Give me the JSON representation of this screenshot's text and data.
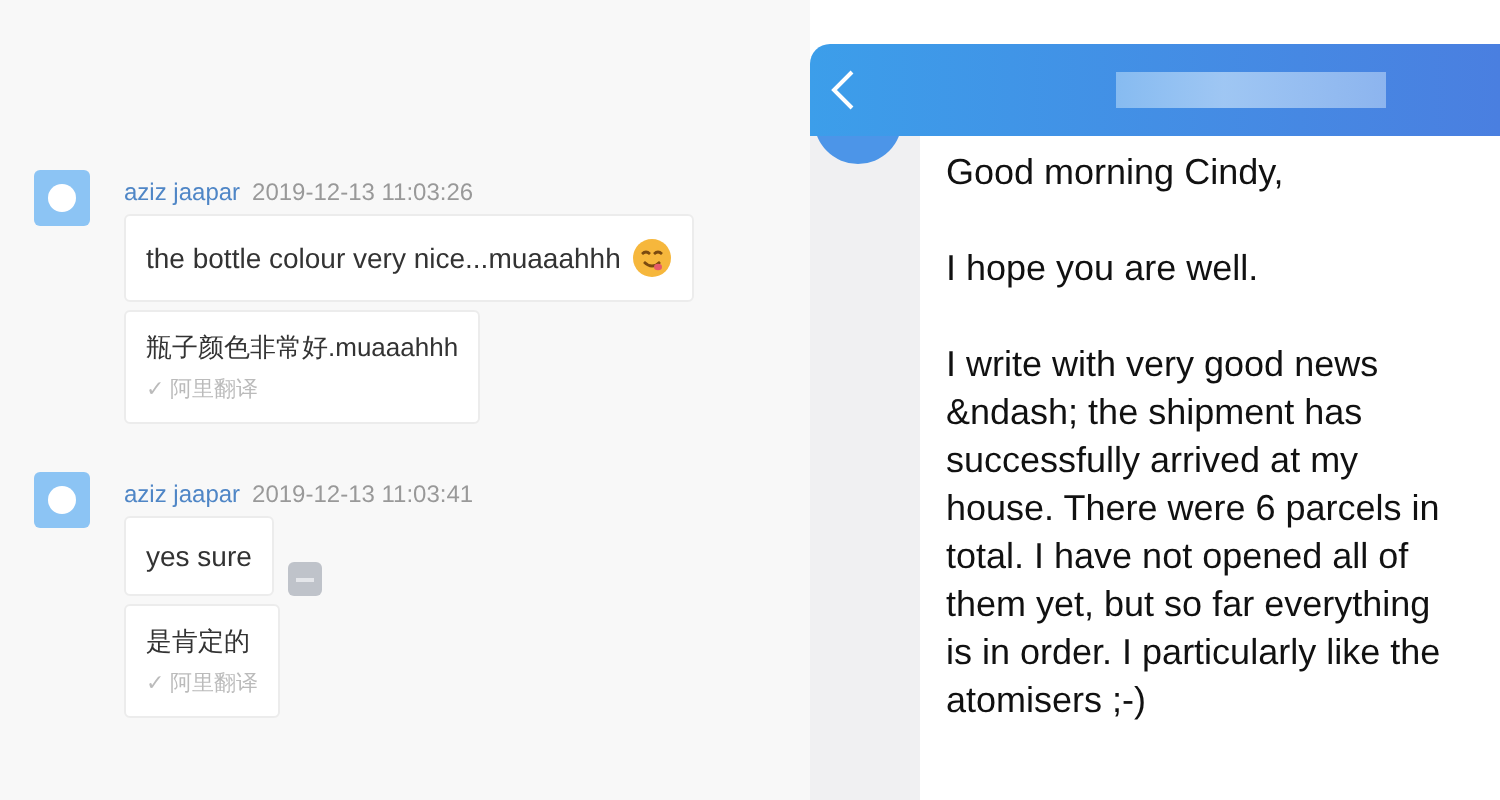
{
  "chat_log": {
    "messages": [
      {
        "sender": "aziz jaapar",
        "time": "2019-12-13 11:03:26",
        "text": "the bottle colour very nice...muaaahhh",
        "has_emoji": true,
        "has_status": false,
        "translation": {
          "text": "瓶子颜色非常好.muaaahhh",
          "label": "✓ 阿里翻译"
        }
      },
      {
        "sender": "aziz jaapar",
        "time": "2019-12-13 11:03:41",
        "text": "yes sure",
        "has_emoji": false,
        "has_status": true,
        "translation": {
          "text": "是肯定的",
          "label": "✓ 阿里翻译"
        }
      }
    ]
  },
  "mobile_chat": {
    "message": {
      "paragraphs": [
        "Good morning Cindy,",
        "I hope you are well.",
        "I write with very good news &ndash; the shipment has successfully arrived at my house. There were 6 parcels in total. I have not opened all of them yet, but so far everything is in order. I particularly like the atomisers ;-)"
      ]
    }
  }
}
